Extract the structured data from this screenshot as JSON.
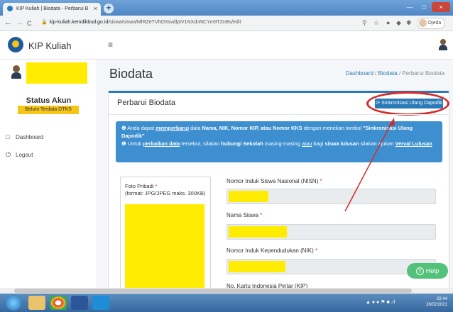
{
  "browser": {
    "tab_title": "KIP Kuliah | Biodata - Perbarui B",
    "tab_close": "×",
    "new_tab": "+",
    "url_domain": "kip-kuliah.kemdikbud.go.id",
    "url_path": "/siswa/siswa/MlRZeTVhOSsvdlpIV1NXdnNCYm9TZnBs/edit",
    "profile_name": "Djeda",
    "nav": {
      "back": "←",
      "forward": "→",
      "reload": "C"
    },
    "window": {
      "minimize": "—",
      "maximize": "□",
      "close": "×"
    }
  },
  "header": {
    "brand": "KIP Kuliah",
    "menu_icon": "≡"
  },
  "sidebar": {
    "status_title": "Status Akun",
    "status_badge": "Belum Terdata DTKS",
    "items": [
      {
        "label": "Dashboard",
        "icon": "monitor-icon"
      },
      {
        "label": "Logout",
        "icon": "power-icon"
      }
    ]
  },
  "main": {
    "page_title": "Biodata",
    "breadcrumb": [
      "Dashboard",
      "Biodata",
      "Perbarui Biodata"
    ],
    "card_title": "Perbarui Biodata",
    "sync_button": "Sinkronisasi Ulang Dapodik",
    "alert": {
      "line1_prefix": "Anda dapat ",
      "line1_link": "memperbarui",
      "line1_mid": " data ",
      "line1_bold": "Nama, NIK, Nomor KIP, atau Nomor KKS",
      "line1_suffix": " dengan menekan tombol ",
      "line1_button": "\"Sinkronisasi Ulang Dapodik\"",
      "line2_prefix": "Untuk ",
      "line2_link1": "perbaikan data",
      "line2_mid1": " tersebut, silakan ",
      "line2_bold1": "hubungi Sekolah",
      "line2_mid2": " masing-masing ",
      "line2_link2": "atau",
      "line2_mid3": " bagi ",
      "line2_bold2": "siswa lulusan",
      "line2_mid4": " silakan ajukan ",
      "line2_link3": "Verval Lulusan"
    },
    "photo": {
      "label": "Foto Pribadi",
      "format": "(format: JPG/JPEG maks. 300KB)"
    },
    "fields": [
      {
        "label": "Nomor Induk Siswa Nasional (NISN)"
      },
      {
        "label": "Nama Siswa"
      },
      {
        "label": "Nomor Induk Kependudukan (NIK)"
      },
      {
        "label": "No. Kartu Indonesia Pintar (KIP)"
      }
    ],
    "help_button": "Help"
  },
  "taskbar": {
    "time": "22:44",
    "date": "26/02/2021"
  },
  "colors": {
    "primary": "#2a7ab8",
    "alert_bg": "#3d8fd0",
    "highlight": "#ffec00",
    "annotation_red": "#d42b2b",
    "help_green": "#52c17a"
  }
}
